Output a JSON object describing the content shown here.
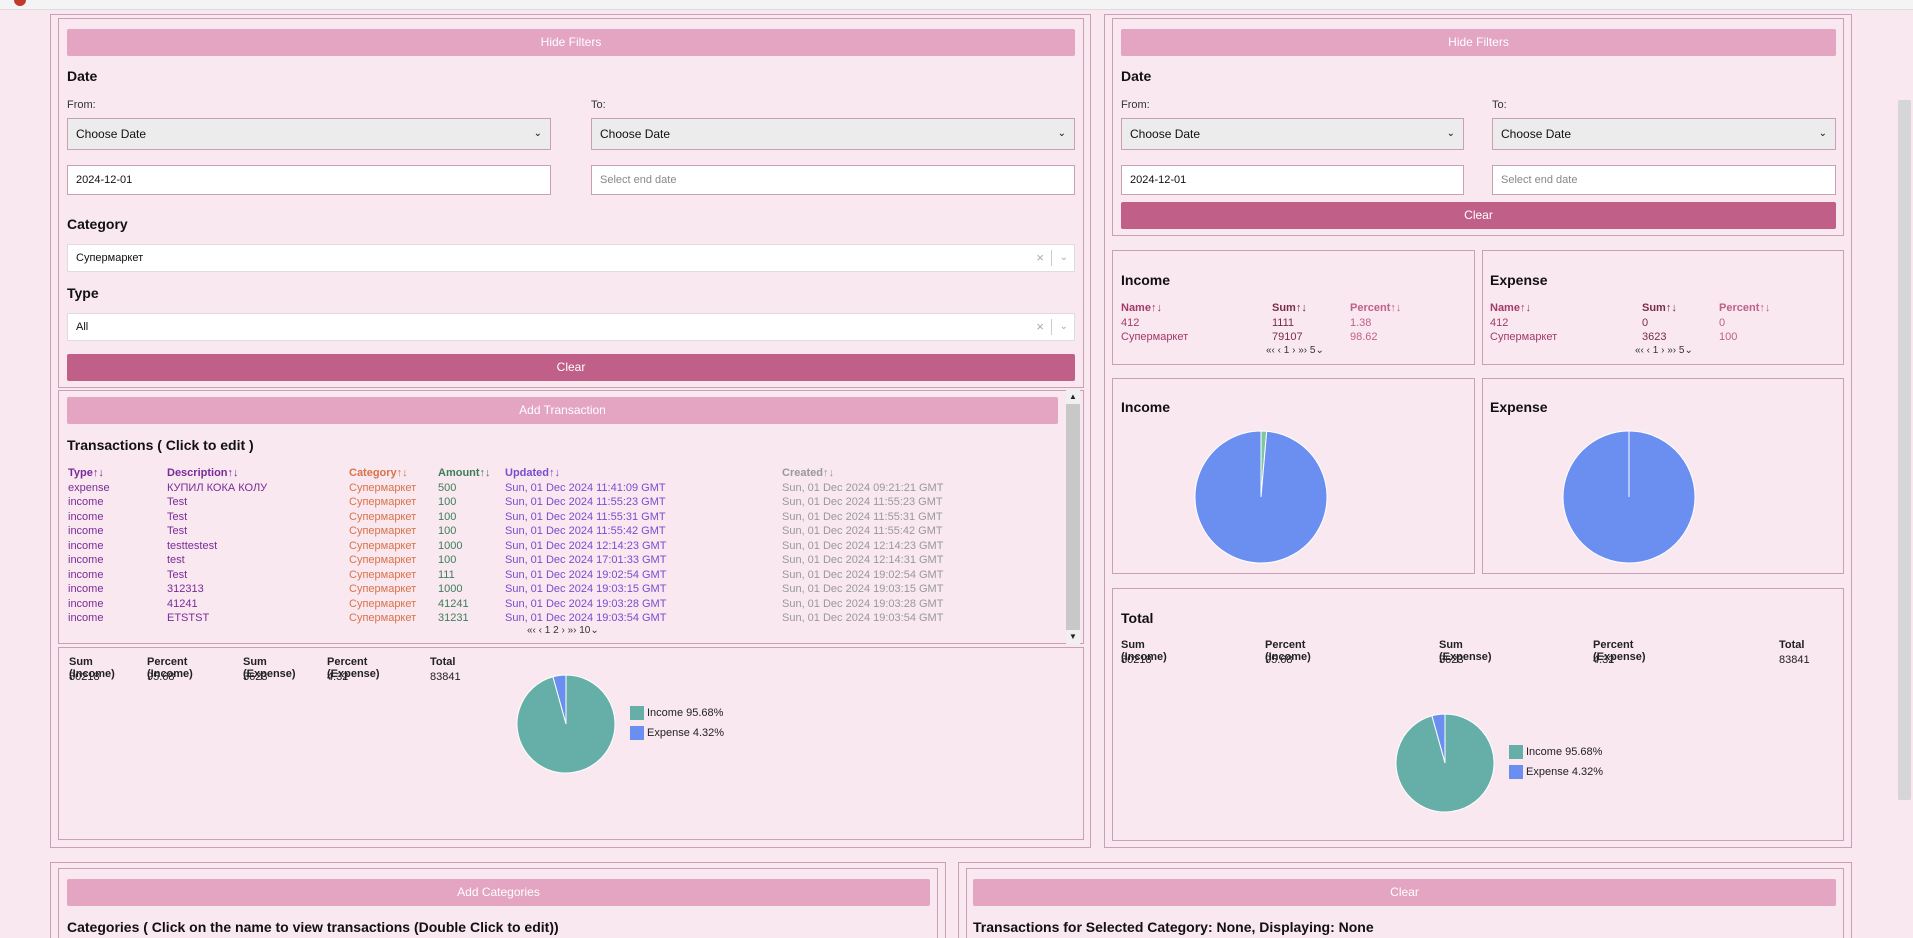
{
  "colors": {
    "accent": "#c06089",
    "accent_light": "#e3a5c1",
    "pie_blue": "#6b8ff0",
    "pie_teal": "#66afa8"
  },
  "left_filters": {
    "hide_filters_label": "Hide Filters",
    "date_title": "Date",
    "from_label": "From:",
    "to_label": "To:",
    "from_select": "Choose Date",
    "to_select": "Choose Date",
    "from_value": "2024-12-01",
    "to_placeholder": "Select end date",
    "category_title": "Category",
    "category_value": "Супермаркет",
    "type_title": "Type",
    "type_value": "All",
    "clear_label": "Clear"
  },
  "transactions": {
    "add_label": "Add Transaction",
    "title": "Transactions ( Click to edit )",
    "headers": [
      "Type↑↓",
      "Description↑↓",
      "Category↑↓",
      "Amount↑↓",
      "Updated↑↓",
      "Created↑↓"
    ],
    "rows": [
      [
        "expense",
        "КУПИЛ КОКА КОЛУ",
        "Супермаркет",
        "500",
        "Sun, 01 Dec 2024 11:41:09 GMT",
        "Sun, 01 Dec 2024 09:21:21 GMT"
      ],
      [
        "income",
        "Test",
        "Супермаркет",
        "100",
        "Sun, 01 Dec 2024 11:55:23 GMT",
        "Sun, 01 Dec 2024 11:55:23 GMT"
      ],
      [
        "income",
        "Test",
        "Супермаркет",
        "100",
        "Sun, 01 Dec 2024 11:55:31 GMT",
        "Sun, 01 Dec 2024 11:55:31 GMT"
      ],
      [
        "income",
        "Test",
        "Супермаркет",
        "100",
        "Sun, 01 Dec 2024 11:55:42 GMT",
        "Sun, 01 Dec 2024 11:55:42 GMT"
      ],
      [
        "income",
        "testtestest",
        "Супермаркет",
        "1000",
        "Sun, 01 Dec 2024 12:14:23 GMT",
        "Sun, 01 Dec 2024 12:14:23 GMT"
      ],
      [
        "income",
        "test",
        "Супермаркет",
        "100",
        "Sun, 01 Dec 2024 17:01:33 GMT",
        "Sun, 01 Dec 2024 12:14:31 GMT"
      ],
      [
        "income",
        "Test",
        "Супермаркет",
        "111",
        "Sun, 01 Dec 2024 19:02:54 GMT",
        "Sun, 01 Dec 2024 19:02:54 GMT"
      ],
      [
        "income",
        "312313",
        "Супермаркет",
        "1000",
        "Sun, 01 Dec 2024 19:03:15 GMT",
        "Sun, 01 Dec 2024 19:03:15 GMT"
      ],
      [
        "income",
        "41241",
        "Супермаркет",
        "41241",
        "Sun, 01 Dec 2024 19:03:28 GMT",
        "Sun, 01 Dec 2024 19:03:28 GMT"
      ],
      [
        "income",
        "ETSTST",
        "Супермаркет",
        "31231",
        "Sun, 01 Dec 2024 19:03:54 GMT",
        "Sun, 01 Dec 2024 19:03:54 GMT"
      ]
    ],
    "pager": "«‹ ‹ 1 2 › »› 10⌄"
  },
  "left_summary": {
    "headers": [
      "Sum (Income)",
      "Percent (Income)",
      "Sum (Expense)",
      "Percent (Expense)",
      "Total"
    ],
    "values": [
      "80218",
      "95.68",
      "3623",
      "4.32",
      "83841"
    ],
    "legend_income": "Income 95.68%",
    "legend_expense": "Expense 4.32%"
  },
  "right_filters": {
    "hide_filters_label": "Hide Filters",
    "date_title": "Date",
    "from_label": "From:",
    "to_label": "To:",
    "from_select": "Choose Date",
    "to_select": "Choose Date",
    "from_value": "2024-12-01",
    "to_placeholder": "Select end date",
    "clear_label": "Clear"
  },
  "income_table": {
    "title": "Income",
    "headers": [
      "Name↑↓",
      "Sum↑↓",
      "Percent↑↓"
    ],
    "rows": [
      [
        "412",
        "1111",
        "1.38"
      ],
      [
        "Супермаркет",
        "79107",
        "98.62"
      ]
    ],
    "pager": "«‹ ‹ 1 › »› 5⌄"
  },
  "expense_table": {
    "title": "Expense",
    "headers": [
      "Name↑↓",
      "Sum↑↓",
      "Percent↑↓"
    ],
    "rows": [
      [
        "412",
        "0",
        "0"
      ],
      [
        "Супермаркет",
        "3623",
        "100"
      ]
    ],
    "pager": "«‹ ‹ 1 › »› 5⌄"
  },
  "income_pie_title": "Income",
  "expense_pie_title": "Expense",
  "total": {
    "title": "Total",
    "headers": [
      "Sum (Income)",
      "Percent (Income)",
      "Sum (Expense)",
      "Percent (Expense)",
      "Total"
    ],
    "values": [
      "80218",
      "95.68",
      "3623",
      "4.32",
      "83841"
    ],
    "legend_income": "Income 95.68%",
    "legend_expense": "Expense 4.32%"
  },
  "bottom_left": {
    "add_label": "Add Categories",
    "title": "Categories ( Click on the name to view transactions (Double Click to edit))"
  },
  "bottom_right": {
    "clear_label": "Clear",
    "title": "Transactions for Selected Category: None, Displaying: None"
  },
  "chart_data": [
    {
      "type": "pie",
      "title": "Income",
      "categories": [
        "412",
        "Супермаркет"
      ],
      "values": [
        1.38,
        98.62
      ]
    },
    {
      "type": "pie",
      "title": "Expense",
      "categories": [
        "412",
        "Супермаркет"
      ],
      "values": [
        0,
        100
      ]
    },
    {
      "type": "pie",
      "title": "",
      "categories": [
        "Income",
        "Expense"
      ],
      "values": [
        95.68,
        4.32
      ]
    },
    {
      "type": "pie",
      "title": "Total",
      "categories": [
        "Income",
        "Expense"
      ],
      "values": [
        95.68,
        4.32
      ]
    }
  ]
}
